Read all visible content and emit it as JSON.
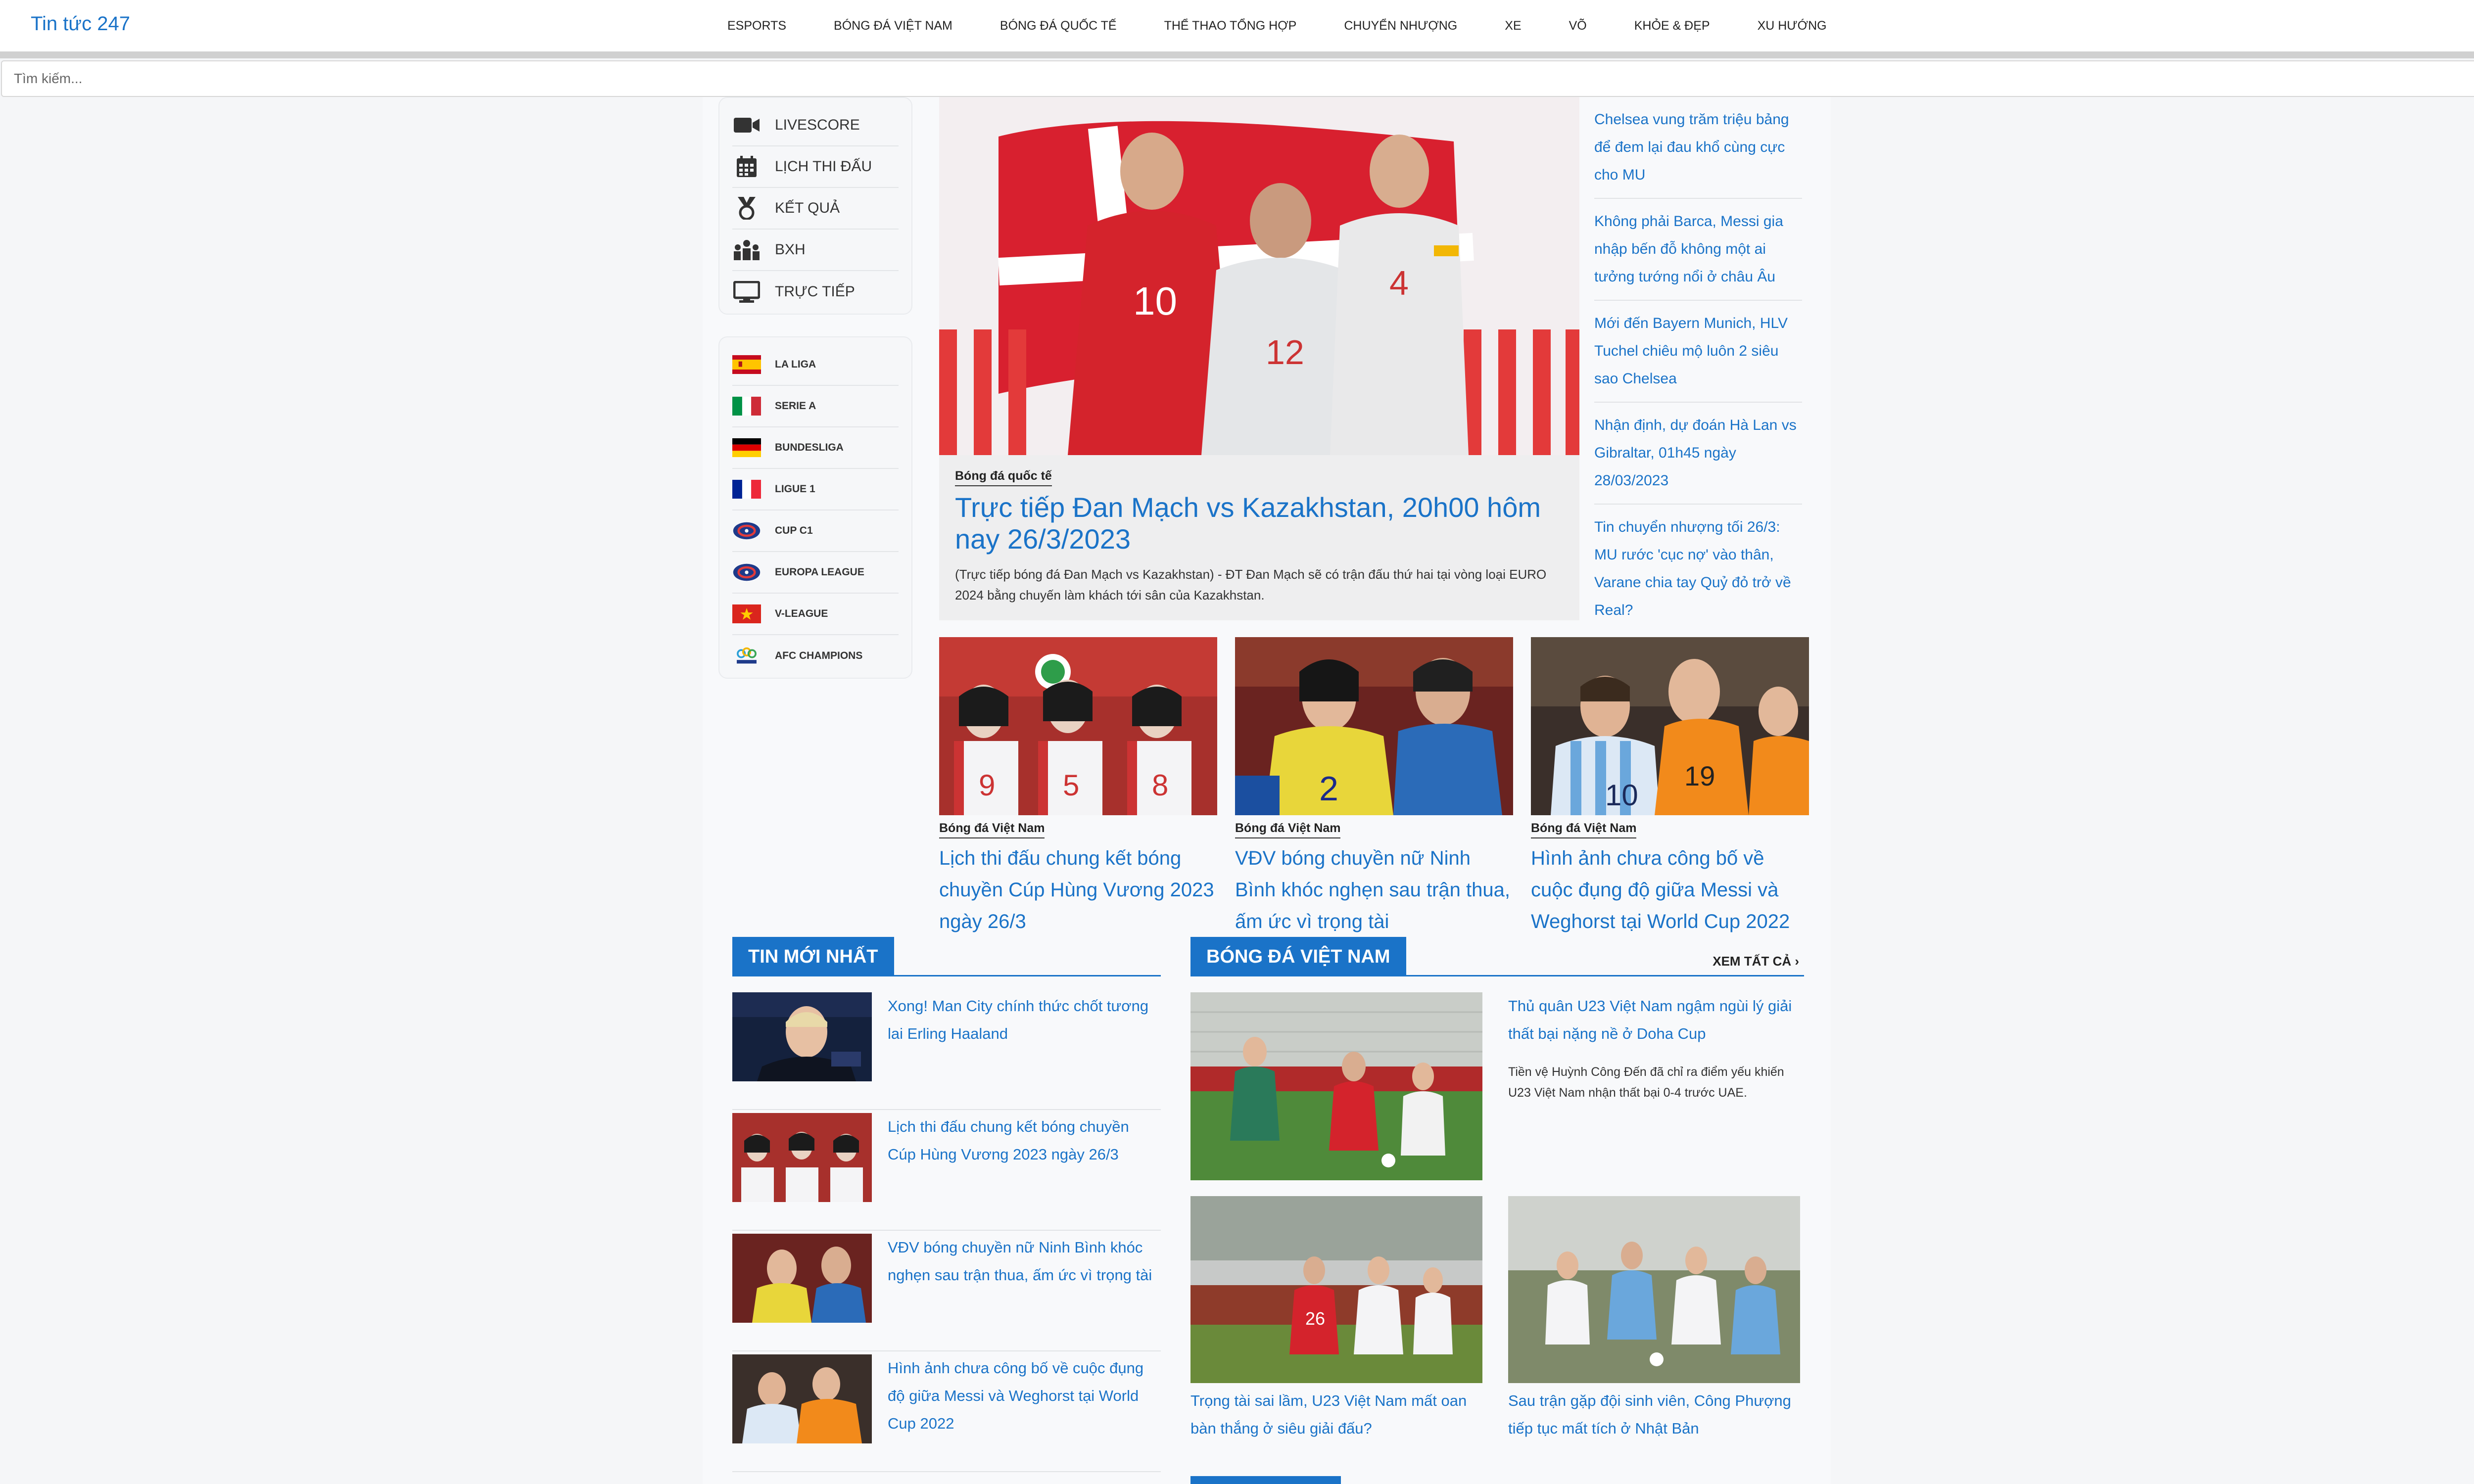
{
  "header": {
    "logo": "Tin tức 247",
    "nav": [
      "Esports",
      "Bóng đá Việt Nam",
      "Bóng đá quốc tế",
      "Thể thao tổng hợp",
      "Chuyển nhượng",
      "Xe",
      "Võ",
      "Khỏe & Đẹp",
      "Xu hướng"
    ]
  },
  "search": {
    "placeholder": "Tìm kiếm..."
  },
  "sidebar": {
    "menu": [
      {
        "label": "Livescore",
        "icon": "video-camera-icon"
      },
      {
        "label": "Lịch thi đấu",
        "icon": "calendar-icon"
      },
      {
        "label": "Kết quả",
        "icon": "medal-icon"
      },
      {
        "label": "BXH",
        "icon": "ranking-icon"
      },
      {
        "label": "Trực tiếp",
        "icon": "monitor-icon"
      }
    ],
    "leagues": [
      {
        "label": "La Liga",
        "icon": "spain-flag-icon"
      },
      {
        "label": "Serie A",
        "icon": "italy-flag-icon"
      },
      {
        "label": "Bundesliga",
        "icon": "germany-flag-icon"
      },
      {
        "label": "Ligue 1",
        "icon": "france-flag-icon"
      },
      {
        "label": "Cup C1",
        "icon": "uefa-logo-icon"
      },
      {
        "label": "Europa League",
        "icon": "uefa-logo-icon"
      },
      {
        "label": "V-League",
        "icon": "vietnam-flag-icon"
      },
      {
        "label": "AFC Champions",
        "icon": "afc-logo-icon"
      }
    ]
  },
  "hero": {
    "category": "Bóng đá quốc tế",
    "title": "Trực tiếp Đan Mạch vs Kazakhstan, 20h00 hôm nay 26/3/2023",
    "description": "(Trực tiếp bóng đá Đan Mạch vs Kazakhstan) - ĐT Đan Mạch sẽ có trận đấu thứ hai tại vòng loại EURO 2024 bằng chuyến làm khách tới sân của Kazakhstan."
  },
  "side_news": [
    "Chelsea vung trăm triệu bảng để đem lại đau khổ cùng cực cho MU",
    "Không phải Barca, Messi gia nhập bến đỗ không một ai tưởng tướng nổi ở châu Âu",
    "Mới đến Bayern Munich, HLV Tuchel chiêu mộ luôn 2 siêu sao Chelsea",
    "Nhận định, dự đoán Hà Lan vs Gibraltar, 01h45 ngày 28/03/2023",
    "Tin chuyển nhượng tối 26/3: MU rước 'cục nợ' vào thân, Varane chia tay Quỷ đỏ trở về Real?"
  ],
  "cards": [
    {
      "category": "Bóng đá Việt Nam",
      "title": "Lịch thi đấu chung kết bóng chuyền Cúp Hùng Vương 2023 ngày 26/3"
    },
    {
      "category": "Bóng đá Việt Nam",
      "title": "VĐV bóng chuyền nữ Ninh Bình khóc nghẹn sau trận thua, ấm ức vì trọng tài"
    },
    {
      "category": "Bóng đá Việt Nam",
      "title": "Hình ảnh chưa công bố về cuộc đụng độ giữa Messi và Weghorst tại World Cup 2022"
    }
  ],
  "latest": {
    "heading": "Tin mới nhất",
    "items": [
      "Xong! Man City chính thức chốt tương lai Erling Haaland",
      "Lịch thi đấu chung kết bóng chuyền Cúp Hùng Vương 2023 ngày 26/3",
      "VĐV bóng chuyền nữ Ninh Bình khóc nghẹn sau trận thua, ấm ức vì trọng tài",
      "Hình ảnh chưa công bố về cuộc đụng độ giữa Messi và Weghorst tại World Cup 2022"
    ]
  },
  "vietnam": {
    "heading": "Bóng đá Việt Nam",
    "see_all": "Xem tất cả ›",
    "feature": {
      "title": "Thủ quân U23 Việt Nam ngậm ngùi lý giải thất bại nặng nề ở Doha Cup",
      "description": "Tiền vệ Huỳnh Công Đến đã chỉ ra điểm yếu khiến U23 Việt Nam nhận thất bại 0-4 trước UAE."
    },
    "cards": [
      "Trọng tài sai lầm, U23 Việt Nam mất oan bàn thắng ở siêu giải đấu?",
      "Sau trận gặp đội sinh viên, Công Phượng tiếp tục mất tích ở Nhật Bản"
    ]
  },
  "colors": {
    "accent": "#1a73c8",
    "nav_bg": "#ffffff",
    "page_bg": "#f5f6f8"
  }
}
